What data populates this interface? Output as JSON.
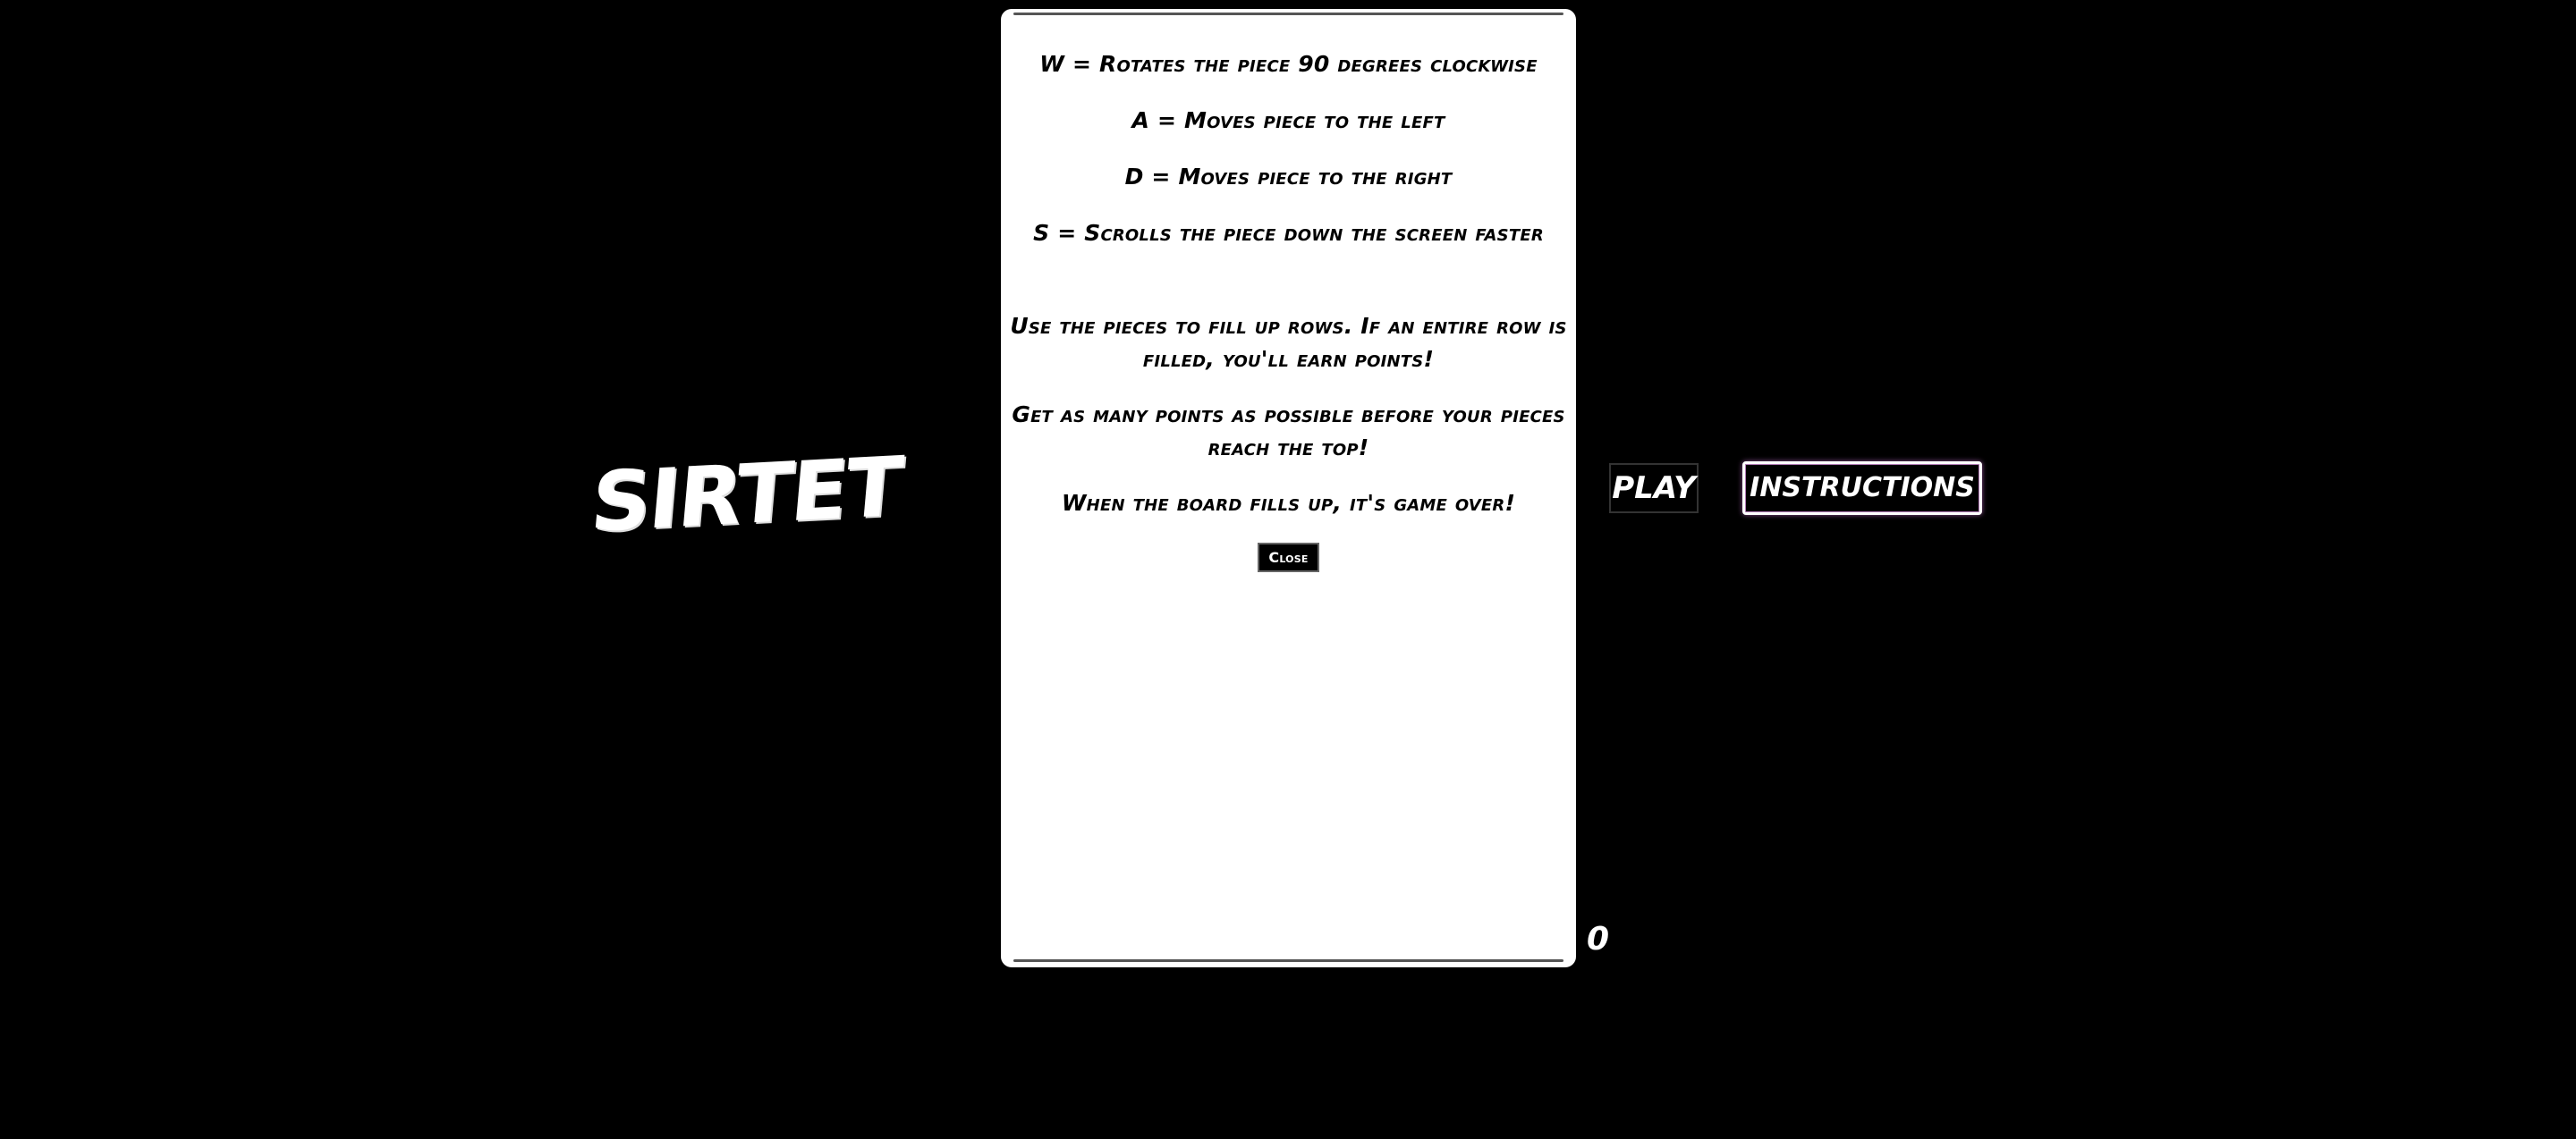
{
  "logo": {
    "text": "SIRTET"
  },
  "modal": {
    "controls": [
      "W = Rotates the piece 90 degrees clockwise",
      "A = Moves piece to the left",
      "D = Moves piece to the right",
      "S = Scrolls the piece down the screen faster"
    ],
    "rules": [
      "Use the pieces to fill up rows. If an entire row is filled, you'll earn points!",
      "Get as many points as possible before your pieces reach the top!",
      "When the board fills up, it's game over!"
    ],
    "close_label": "Close"
  },
  "score": {
    "value": "0"
  },
  "menu": {
    "play_label": "PLAY",
    "instructions_label": "INSTRUCTIONS"
  },
  "colors": {
    "background": "#000000",
    "board": "#ffffff",
    "accent": "#b47bb8"
  }
}
